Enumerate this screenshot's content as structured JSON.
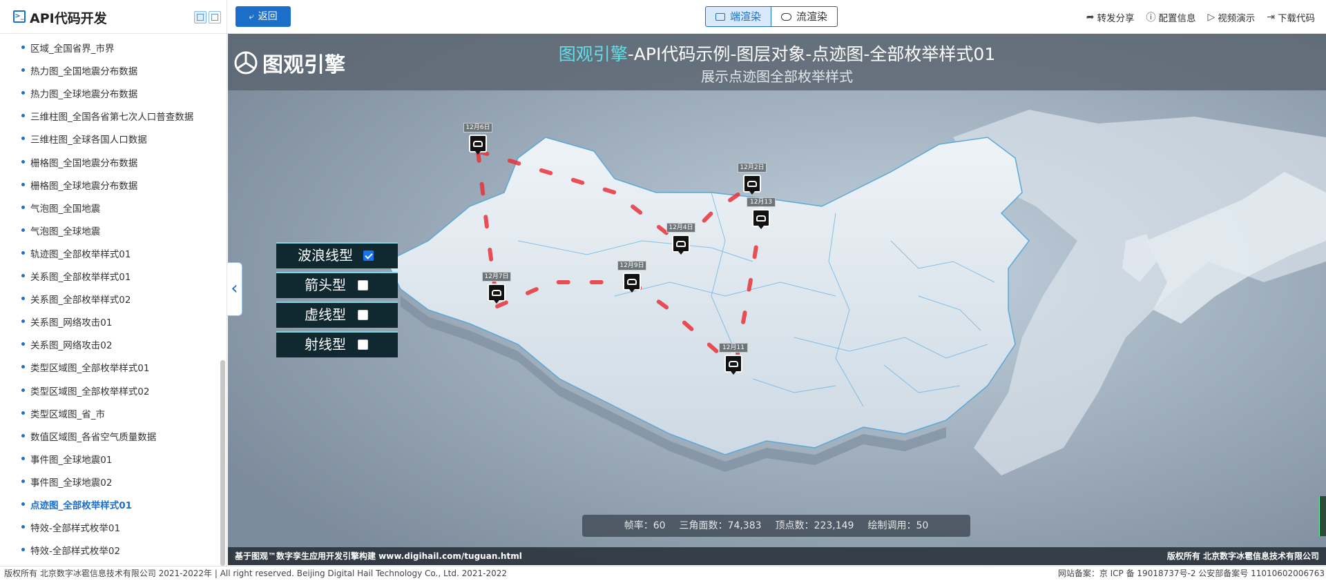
{
  "sidebar": {
    "title": "API代码开发",
    "items": [
      {
        "label": "区域_全国省界_市界"
      },
      {
        "label": "热力图_全国地震分布数据"
      },
      {
        "label": "热力图_全球地震分布数据"
      },
      {
        "label": "三维柱图_全国各省第七次人口普查数据"
      },
      {
        "label": "三维柱图_全球各国人口数据"
      },
      {
        "label": "栅格图_全国地震分布数据"
      },
      {
        "label": "栅格图_全球地震分布数据"
      },
      {
        "label": "气泡图_全国地震"
      },
      {
        "label": "气泡图_全球地震"
      },
      {
        "label": "轨迹图_全部枚举样式01"
      },
      {
        "label": "关系图_全部枚举样式01"
      },
      {
        "label": "关系图_全部枚举样式02"
      },
      {
        "label": "关系图_网络攻击01"
      },
      {
        "label": "关系图_网络攻击02"
      },
      {
        "label": "类型区域图_全部枚举样式01"
      },
      {
        "label": "类型区域图_全部枚举样式02"
      },
      {
        "label": "类型区域图_省_市"
      },
      {
        "label": "数值区域图_各省空气质量数据"
      },
      {
        "label": "事件图_全球地震01"
      },
      {
        "label": "事件图_全球地震02"
      },
      {
        "label": "点迹图_全部枚举样式01",
        "active": true
      },
      {
        "label": "特效-全部样式枚举01"
      },
      {
        "label": "特效-全部样式枚举02"
      }
    ]
  },
  "topbar": {
    "back_label": "返回",
    "render_client": "端渲染",
    "render_stream": "流渲染",
    "actions": [
      "转发分享",
      "配置信息",
      "视频演示",
      "下载代码"
    ]
  },
  "map": {
    "brand": "图观引擎",
    "title_highlight": "图观引擎",
    "title_rest": "-API代码示例-图层对象-点迹图-全部枚举样式01",
    "subtitle": "展示点迹图全部枚举样式",
    "styles": [
      {
        "label": "波浪线型",
        "checked": true
      },
      {
        "label": "箭头型",
        "checked": false
      },
      {
        "label": "虚线型",
        "checked": false
      },
      {
        "label": "射线型",
        "checked": false
      }
    ],
    "markers": [
      "12月6日",
      "12月2日",
      "12月13日",
      "12月4日",
      "12月9日",
      "12月7日",
      "12月11日"
    ],
    "stats": {
      "fps_label": "帧率：",
      "fps": "60",
      "tri_label": "三角面数：",
      "tri": "74,383",
      "vert_label": "顶点数：",
      "vert": "223,149",
      "draw_label": "绘制调用：",
      "draw": "50"
    },
    "footer_left": "基于图观™数字孪生应用开发引擎构建 www.digihail.com/tuguan.html",
    "footer_right": "版权所有 北京数字冰雹信息技术有限公司"
  },
  "footer": {
    "left": "版权所有 北京数字冰雹信息技术有限公司 2021-2022年 | All right reserved. Beijing Digital Hail Technology Co., Ltd. 2021-2022",
    "right": "网站备案：京 ICP 备 19018737号-2 公安部备案号 11010602006763"
  },
  "colors": {
    "accent": "#1c6fc9",
    "title_highlight": "#5fe0e8",
    "path": "#e8333a"
  }
}
